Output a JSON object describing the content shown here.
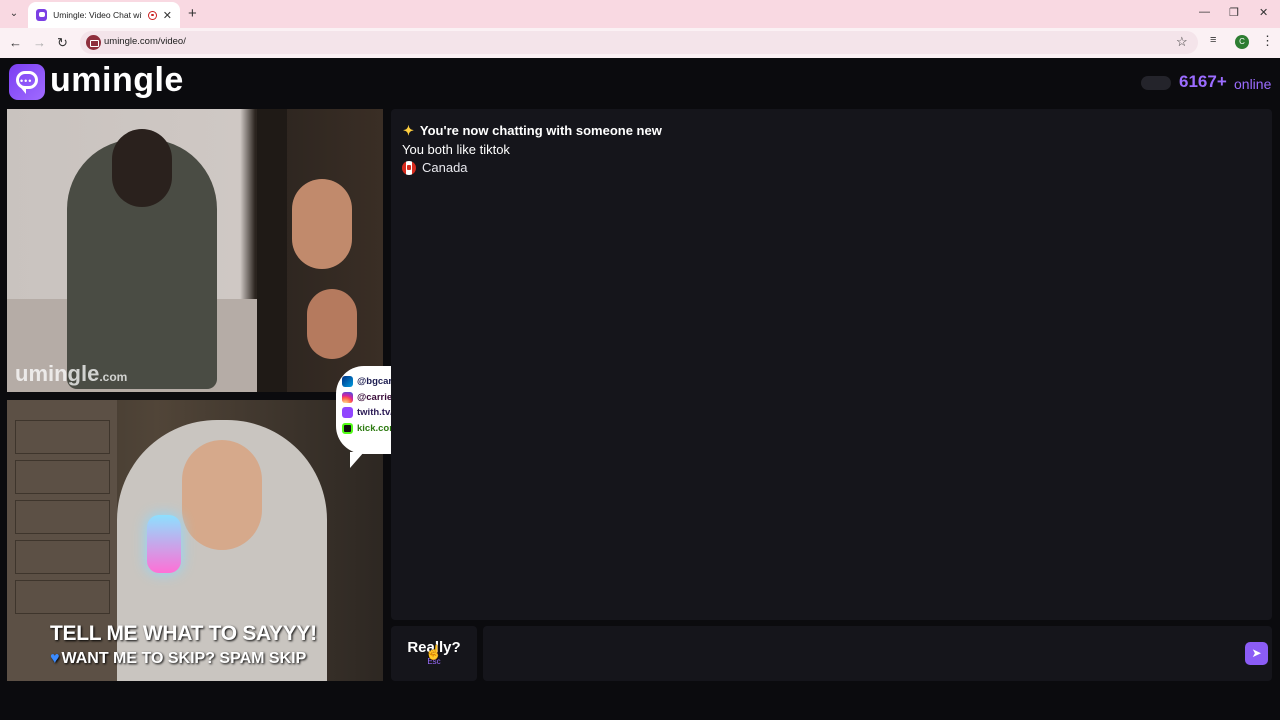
{
  "browser": {
    "tab_title": "Umingle: Video Chat with St",
    "tab_close": "✕",
    "new_tab": "+",
    "url": "umingle.com/video/",
    "profile_initial": "C",
    "window_controls": [
      "—",
      "❐",
      "✕"
    ]
  },
  "header": {
    "brand": "umingle",
    "online_count": "6167+",
    "online_label": "online",
    "accent_color": "#9b6cff"
  },
  "videos": {
    "stranger_watermark": "umingle",
    "stranger_watermark_suffix": ".com",
    "self_overlay_line1": "TELL ME WHAT TO SAYYY!",
    "self_overlay_line2": "WANT ME TO SKIP? SPAM SKIP"
  },
  "socials": [
    {
      "icon": "paypal-icon",
      "handle": "@bgcarrie"
    },
    {
      "icon": "instagram-icon",
      "handle": "@carrienoonim"
    },
    {
      "icon": "twitch-icon",
      "handle": "twith.tv/carrienoona"
    },
    {
      "icon": "kick-icon",
      "handle": "kick.com/carrienoona"
    }
  ],
  "chat": {
    "intro": "You're now chatting with someone new",
    "common_interest": "You both like tiktok",
    "country": "Canada"
  },
  "controls": {
    "skip_label": "Really?",
    "skip_hint": "Esc",
    "message_placeholder": "",
    "send_icon": "send-icon"
  }
}
